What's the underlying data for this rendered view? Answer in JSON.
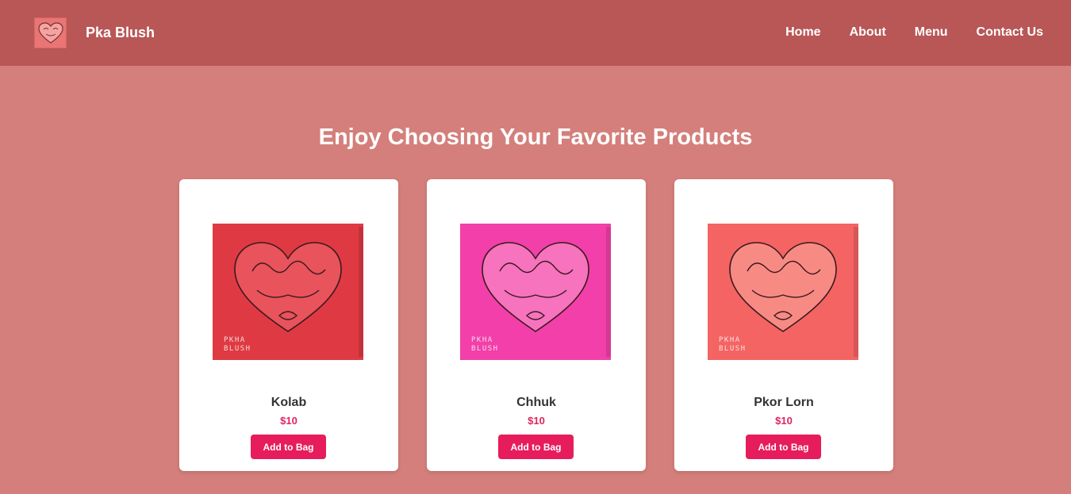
{
  "header": {
    "brand": "Pka Blush",
    "logo_icon": "blush-heart-logo-icon",
    "nav": [
      {
        "label": "Home"
      },
      {
        "label": "About"
      },
      {
        "label": "Menu"
      },
      {
        "label": "Contact Us"
      }
    ]
  },
  "main": {
    "heading": "Enjoy Choosing Your Favorite Products"
  },
  "products": [
    {
      "name": "Kolab",
      "price": "$10",
      "button_label": "Add to Bag",
      "box_color": "#df3a43",
      "heart_color": "#e8535c",
      "image_text": [
        "PKHA",
        "BLUSH"
      ]
    },
    {
      "name": "Chhuk",
      "price": "$10",
      "button_label": "Add to Bag",
      "box_color": "#f23fa9",
      "heart_color": "#f773bd",
      "image_text": [
        "PKHA",
        "BLUSH"
      ]
    },
    {
      "name": "Pkor Lorn",
      "price": "$10",
      "button_label": "Add to Bag",
      "box_color": "#f46463",
      "heart_color": "#f88a84",
      "image_text": [
        "PKHA",
        "BLUSH"
      ]
    }
  ],
  "colors": {
    "background": "#d47f7b",
    "navbar": "#b85756",
    "accent": "#e61c5d",
    "price": "#e0245e"
  }
}
